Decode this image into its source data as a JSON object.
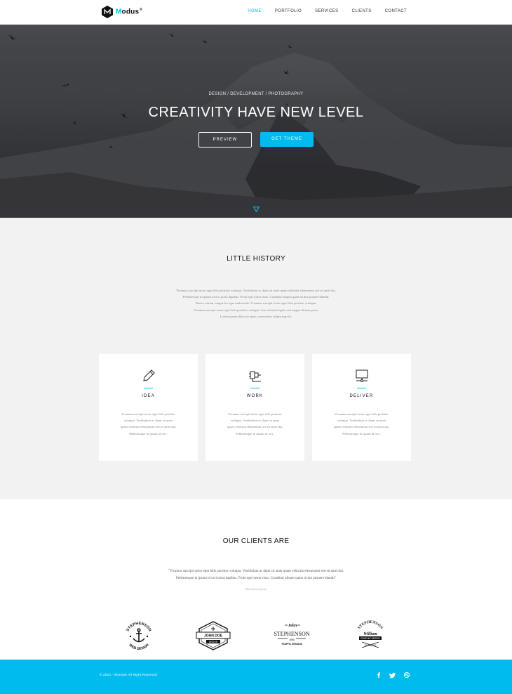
{
  "brand": {
    "name_first": "M",
    "name_rest": "odus",
    "registered": "®"
  },
  "nav": {
    "items": [
      {
        "label": "HOME",
        "active": true
      },
      {
        "label": "PORTFOLIO",
        "active": false
      },
      {
        "label": "SERVICES",
        "active": false
      },
      {
        "label": "CLIENTS",
        "active": false
      },
      {
        "label": "CONTACT",
        "active": false
      }
    ]
  },
  "hero": {
    "subtitle": "DESIGN / DEVELOPMENT / PHOTOGRAPHY",
    "title": "CREATIVITY HAVE NEW LEVEL",
    "preview_label": "PREVIEW",
    "get_theme_label": "GET THEME"
  },
  "history": {
    "title": "LITTLE HISTORY",
    "lines": [
      "Vivamus suscipit tortor eget felis porttitor volutpat. Vestibulum ac diam sit amet quam vehicula elementum sed sit amet dui.",
      "Pellentesque in ipsum id orci porta dapibus. Proin eget tortor risus. Curabitur aliquet quam id dui posuere blandit.",
      "Donec rutrum congue leo eget malesuada. Vivamus suscipit tortor eget felis porttitor volutpat.",
      "Vivamus suscipit tortor eget felis porttitor volutpat. Cras ultricies ligula sed magna dictum porta.",
      "Lorem ipsum dolor sit amet, consectetur adipiscing elit."
    ]
  },
  "cards": [
    {
      "icon": "pencil-icon",
      "title": "IDEA",
      "lines": [
        "Vivamus suscipit tortor eget felis porttitor",
        "volutpat. Vestibulum ac diam sit amet",
        "quam vehicula elementum sed sit amet dui.",
        "Pellentesque in ipsum id orci."
      ]
    },
    {
      "icon": "plug-icon",
      "title": "WORK",
      "lines": [
        "Vivamus suscipit tortor eget felis porttitor",
        "volutpat. Vestibulum ac diam sit amet",
        "quam vehicula elementum sed sit amet dui.",
        "Pellentesque in ipsum id orci."
      ]
    },
    {
      "icon": "monitor-icon",
      "title": "DELIVER",
      "lines": [
        "Vivamus suscipit tortor eget felis porttitor",
        "volutpat. Vestibulum ac diam sit amet",
        "quam vehicula elementum sed sit amet dui.",
        "Pellentesque in ipsum id orci."
      ]
    }
  ],
  "clients": {
    "title": "OUR CLIENTS ARE",
    "quote_lines": [
      "\"Vivamus suscipit tortor eget felis porttitor volutpat. Vestibulum ac diam sit amet quam vehicula elementum sed sit amet dui.",
      "Pellentesque in ipsum id orci porta dapibus. Proin eget tortor risus. Curabitur aliquet quam id dui posuere blandit\""
    ],
    "quote_author": "Mr.Lorem Ipsum",
    "logos": [
      {
        "icon": "anchor-icon",
        "top_text": "STEPHENSON",
        "bottom_text": "WEB DESIGN"
      },
      {
        "icon": "hexagon-badge-icon",
        "main_text": "JOHN DOE",
        "sub_text": "DESIGN"
      },
      {
        "icon": "script-badge-icon",
        "top_text": "John",
        "main_text": "STEPHENSON",
        "year": "1990",
        "sub_text": "TRAFFIC DESIGNS"
      },
      {
        "icon": "circle-badge-icon",
        "top_text": "STEPHENSON",
        "main_text": "William",
        "ribbon": "GRAPHIC DESIGN",
        "sub_text": "SINCE 1990"
      }
    ]
  },
  "footer": {
    "copyright": "© 2014 - Wonster All Right Reserved",
    "social": [
      "facebook-icon",
      "twitter-icon",
      "dribbble-icon"
    ]
  },
  "colors": {
    "accent": "#00bcee",
    "hero_dark": "#3a3c40",
    "section_gray": "#f2f2f2"
  }
}
